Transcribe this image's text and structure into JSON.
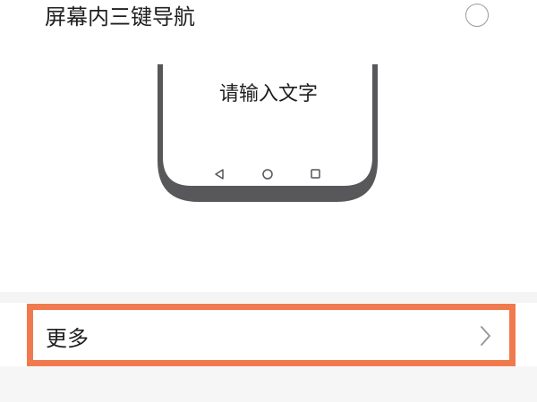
{
  "navigation_option": {
    "label": "屏幕内三键导航",
    "selected": false
  },
  "preview": {
    "placeholder_text": "请输入文字",
    "nav_icons": [
      "back-triangle-icon",
      "home-circle-icon",
      "recents-square-icon"
    ]
  },
  "more_row": {
    "label": "更多",
    "icon": "chevron-right-icon"
  },
  "colors": {
    "highlight": "#f07a4d",
    "phone_frame": "#58585b"
  }
}
